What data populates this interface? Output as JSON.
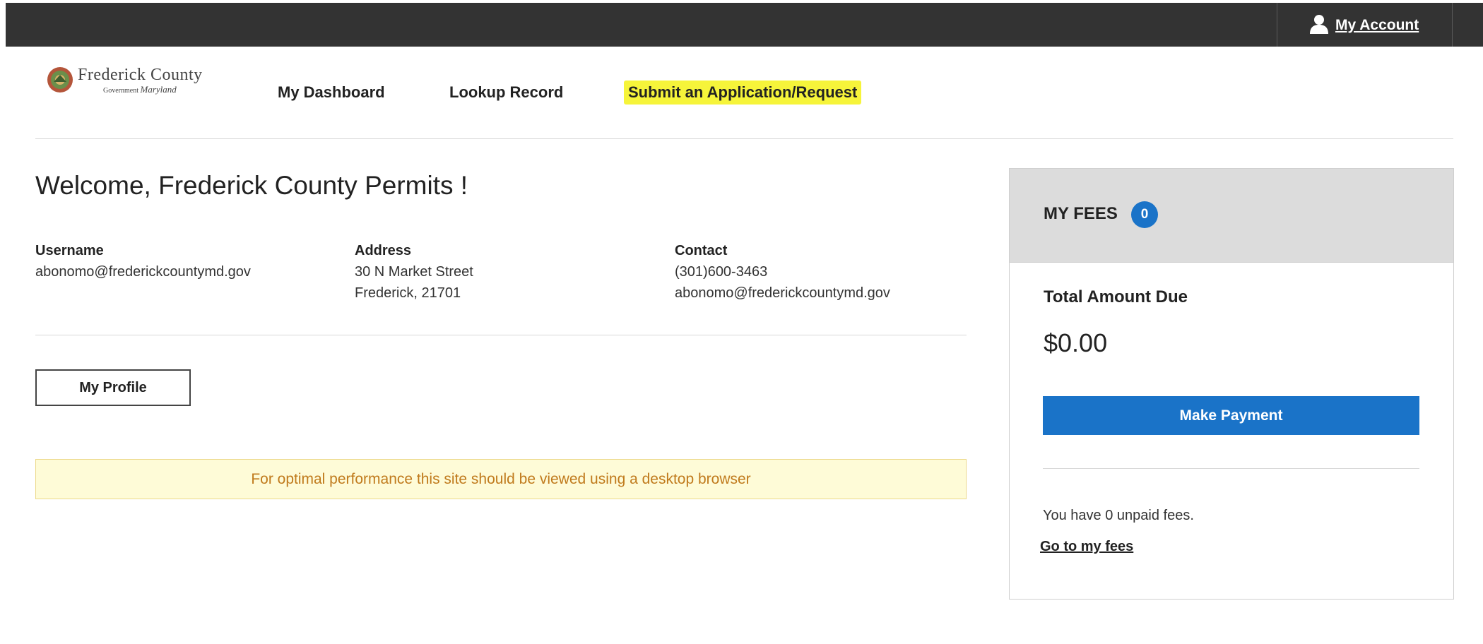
{
  "header": {
    "account_label": "My Account"
  },
  "logo": {
    "title": "Frederick County",
    "subtitle_prefix": "Government",
    "subtitle_script": "Maryland"
  },
  "nav": {
    "dashboard": "My Dashboard",
    "lookup": "Lookup Record",
    "submit": "Submit an Application/Request"
  },
  "main": {
    "welcome": "Welcome, Frederick County Permits !",
    "username_label": "Username",
    "username_value": "abonomo@frederickcountymd.gov",
    "address_label": "Address",
    "address_line1": "30 N Market Street",
    "address_line2": "Frederick, 21701",
    "contact_label": "Contact",
    "contact_phone": "(301)600-3463",
    "contact_email": "abonomo@frederickcountymd.gov",
    "profile_button": "My Profile",
    "notice": "For optimal performance this site should be viewed using a desktop browser"
  },
  "fees": {
    "title": "MY FEES",
    "badge_count": "0",
    "total_label": "Total Amount Due",
    "total_amount": "$0.00",
    "pay_button": "Make Payment",
    "unpaid_text": "You have 0 unpaid fees.",
    "go_link": "Go to my fees"
  },
  "colors": {
    "topbar": "#333333",
    "accent_blue": "#1a73c8",
    "highlight": "#f6f43a",
    "notice_bg": "#fefbd7",
    "notice_text": "#c07a1c"
  }
}
